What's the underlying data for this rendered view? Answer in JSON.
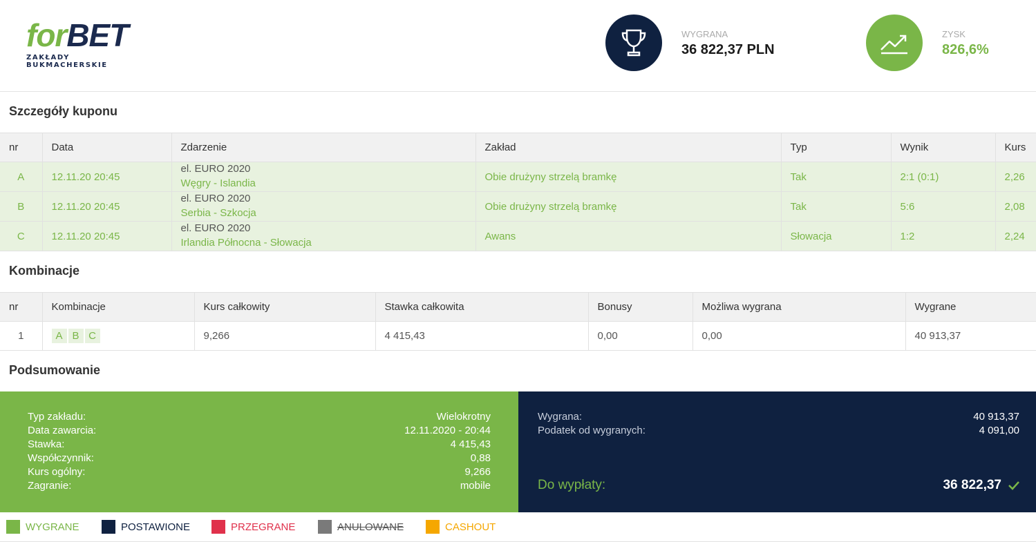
{
  "brand": {
    "logo_part1": "for",
    "logo_part2": "BET",
    "tagline": "ZAKŁADY BUKMACHERSKIE",
    "green": "#7ab648",
    "navy": "#0f2140"
  },
  "header": {
    "win": {
      "icon": "trophy-icon",
      "label": "WYGRANA",
      "value": "36 822,37 PLN"
    },
    "profit": {
      "icon": "trend-up-icon",
      "label": "ZYSK",
      "value": "826,6%"
    }
  },
  "coupon": {
    "title": "Szczegóły kuponu",
    "columns": [
      "nr",
      "Data",
      "Zdarzenie",
      "Zakład",
      "Typ",
      "Wynik",
      "Kurs"
    ],
    "rows": [
      {
        "nr": "A",
        "date": "12.11.20 20:45",
        "competition": "el. EURO 2020",
        "event": "Węgry - Islandia",
        "bet": "Obie drużyny strzelą bramkę",
        "type": "Tak",
        "result": "2:1 (0:1)",
        "odds": "2,26"
      },
      {
        "nr": "B",
        "date": "12.11.20 20:45",
        "competition": "el. EURO 2020",
        "event": "Serbia - Szkocja",
        "bet": "Obie drużyny strzelą bramkę",
        "type": "Tak",
        "result": "5:6",
        "odds": "2,08"
      },
      {
        "nr": "C",
        "date": "12.11.20 20:45",
        "competition": "el. EURO 2020",
        "event": "Irlandia Północna - Słowacja",
        "bet": "Awans",
        "type": "Słowacja",
        "result": "1:2",
        "odds": "2,24"
      }
    ]
  },
  "combinations": {
    "title": "Kombinacje",
    "columns": [
      "nr",
      "Kombinacje",
      "Kurs całkowity",
      "Stawka całkowita",
      "Bonusy",
      "Możliwa wygrana",
      "Wygrane"
    ],
    "rows": [
      {
        "nr": "1",
        "legs": [
          "A",
          "B",
          "C"
        ],
        "total_odds": "9,266",
        "total_stake": "4 415,43",
        "bonus": "0,00",
        "possible_win": "0,00",
        "won": "40 913,37"
      }
    ]
  },
  "summary": {
    "title": "Podsumowanie",
    "left": [
      {
        "label": "Typ zakładu:",
        "value": "Wielokrotny"
      },
      {
        "label": "Data zawarcia:",
        "value": "12.11.2020 - 20:44"
      },
      {
        "label": "Stawka:",
        "value": "4 415,43"
      },
      {
        "label": "Współczynnik:",
        "value": "0,88"
      },
      {
        "label": "Kurs ogólny:",
        "value": "9,266"
      },
      {
        "label": "Zagranie:",
        "value": "mobile"
      }
    ],
    "right": [
      {
        "label": "Wygrana:",
        "value": "40 913,37"
      },
      {
        "label": "Podatek od wygranych:",
        "value": "4 091,00"
      }
    ],
    "payout_label": "Do wypłaty:",
    "payout_value": "36 822,37"
  },
  "legend": [
    {
      "label": "WYGRANE",
      "color": "#7ab648",
      "text_color": "#7ab648"
    },
    {
      "label": "POSTAWIONE",
      "color": "#0f2140",
      "text_color": "#0f2140"
    },
    {
      "label": "PRZEGRANE",
      "color": "#e0314b",
      "text_color": "#e0314b"
    },
    {
      "label": "ANULOWANE",
      "color": "#7a7a7a",
      "text_color": "#555555"
    },
    {
      "label": "CASHOUT",
      "color": "#f5a700",
      "text_color": "#f5a700"
    }
  ]
}
